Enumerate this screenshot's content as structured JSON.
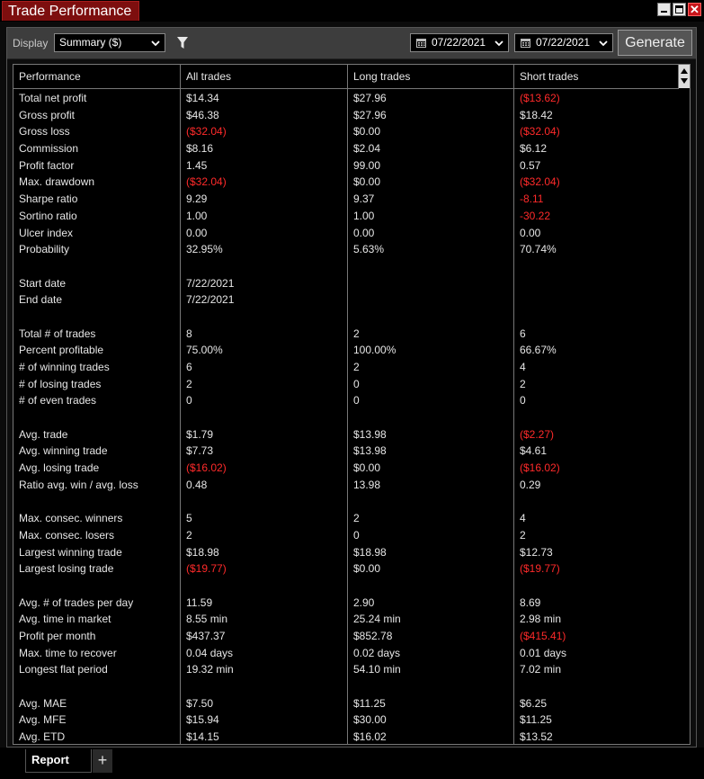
{
  "window": {
    "title": "Trade Performance"
  },
  "toolbar": {
    "display_label": "Display",
    "display_value": "Summary ($)",
    "start_date": "07/22/2021",
    "end_date": "07/22/2021",
    "generate_label": "Generate"
  },
  "table": {
    "headers": [
      "Performance",
      "All trades",
      "Long trades",
      "Short trades"
    ],
    "rows": [
      {
        "label": "Total net profit",
        "all": "$14.34",
        "long": "$27.96",
        "short": "($13.62)",
        "neg": [
          false,
          false,
          true
        ]
      },
      {
        "label": "Gross profit",
        "all": "$46.38",
        "long": "$27.96",
        "short": "$18.42",
        "neg": [
          false,
          false,
          false
        ]
      },
      {
        "label": "Gross loss",
        "all": "($32.04)",
        "long": "$0.00",
        "short": "($32.04)",
        "neg": [
          true,
          false,
          true
        ]
      },
      {
        "label": "Commission",
        "all": "$8.16",
        "long": "$2.04",
        "short": "$6.12",
        "neg": [
          false,
          false,
          false
        ]
      },
      {
        "label": "Profit factor",
        "all": "1.45",
        "long": "99.00",
        "short": "0.57",
        "neg": [
          false,
          false,
          false
        ]
      },
      {
        "label": "Max. drawdown",
        "all": "($32.04)",
        "long": "$0.00",
        "short": "($32.04)",
        "neg": [
          true,
          false,
          true
        ]
      },
      {
        "label": "Sharpe ratio",
        "all": "9.29",
        "long": "9.37",
        "short": "-8.11",
        "neg": [
          false,
          false,
          true
        ]
      },
      {
        "label": "Sortino ratio",
        "all": "1.00",
        "long": "1.00",
        "short": "-30.22",
        "neg": [
          false,
          false,
          true
        ]
      },
      {
        "label": "Ulcer index",
        "all": "0.00",
        "long": "0.00",
        "short": "0.00",
        "neg": [
          false,
          false,
          false
        ]
      },
      {
        "label": "Probability",
        "all": "32.95%",
        "long": "5.63%",
        "short": "70.74%",
        "neg": [
          false,
          false,
          false
        ]
      },
      {
        "label": "",
        "all": "",
        "long": "",
        "short": "",
        "neg": [
          false,
          false,
          false
        ]
      },
      {
        "label": "Start date",
        "all": "7/22/2021",
        "long": "",
        "short": "",
        "neg": [
          false,
          false,
          false
        ]
      },
      {
        "label": "End date",
        "all": "7/22/2021",
        "long": "",
        "short": "",
        "neg": [
          false,
          false,
          false
        ]
      },
      {
        "label": "",
        "all": "",
        "long": "",
        "short": "",
        "neg": [
          false,
          false,
          false
        ]
      },
      {
        "label": "Total # of trades",
        "all": "8",
        "long": "2",
        "short": "6",
        "neg": [
          false,
          false,
          false
        ]
      },
      {
        "label": "Percent profitable",
        "all": "75.00%",
        "long": "100.00%",
        "short": "66.67%",
        "neg": [
          false,
          false,
          false
        ]
      },
      {
        "label": "# of winning trades",
        "all": "6",
        "long": "2",
        "short": "4",
        "neg": [
          false,
          false,
          false
        ]
      },
      {
        "label": "# of losing trades",
        "all": "2",
        "long": "0",
        "short": "2",
        "neg": [
          false,
          false,
          false
        ]
      },
      {
        "label": "# of even trades",
        "all": "0",
        "long": "0",
        "short": "0",
        "neg": [
          false,
          false,
          false
        ]
      },
      {
        "label": "",
        "all": "",
        "long": "",
        "short": "",
        "neg": [
          false,
          false,
          false
        ]
      },
      {
        "label": "Avg. trade",
        "all": "$1.79",
        "long": "$13.98",
        "short": "($2.27)",
        "neg": [
          false,
          false,
          true
        ]
      },
      {
        "label": "Avg. winning trade",
        "all": "$7.73",
        "long": "$13.98",
        "short": "$4.61",
        "neg": [
          false,
          false,
          false
        ]
      },
      {
        "label": "Avg. losing trade",
        "all": "($16.02)",
        "long": "$0.00",
        "short": "($16.02)",
        "neg": [
          true,
          false,
          true
        ]
      },
      {
        "label": "Ratio avg. win / avg. loss",
        "all": "0.48",
        "long": "13.98",
        "short": "0.29",
        "neg": [
          false,
          false,
          false
        ]
      },
      {
        "label": "",
        "all": "",
        "long": "",
        "short": "",
        "neg": [
          false,
          false,
          false
        ]
      },
      {
        "label": "Max. consec. winners",
        "all": "5",
        "long": "2",
        "short": "4",
        "neg": [
          false,
          false,
          false
        ]
      },
      {
        "label": "Max. consec. losers",
        "all": "2",
        "long": "0",
        "short": "2",
        "neg": [
          false,
          false,
          false
        ]
      },
      {
        "label": "Largest winning trade",
        "all": "$18.98",
        "long": "$18.98",
        "short": "$12.73",
        "neg": [
          false,
          false,
          false
        ]
      },
      {
        "label": "Largest losing trade",
        "all": "($19.77)",
        "long": "$0.00",
        "short": "($19.77)",
        "neg": [
          true,
          false,
          true
        ]
      },
      {
        "label": "",
        "all": "",
        "long": "",
        "short": "",
        "neg": [
          false,
          false,
          false
        ]
      },
      {
        "label": "Avg. # of trades per day",
        "all": "11.59",
        "long": "2.90",
        "short": "8.69",
        "neg": [
          false,
          false,
          false
        ]
      },
      {
        "label": "Avg. time in market",
        "all": "8.55 min",
        "long": "25.24 min",
        "short": "2.98 min",
        "neg": [
          false,
          false,
          false
        ]
      },
      {
        "label": "Profit per month",
        "all": "$437.37",
        "long": "$852.78",
        "short": "($415.41)",
        "neg": [
          false,
          false,
          true
        ]
      },
      {
        "label": "Max. time to recover",
        "all": "0.04 days",
        "long": "0.02 days",
        "short": "0.01 days",
        "neg": [
          false,
          false,
          false
        ]
      },
      {
        "label": "Longest flat period",
        "all": "19.32 min",
        "long": "54.10 min",
        "short": "7.02 min",
        "neg": [
          false,
          false,
          false
        ]
      },
      {
        "label": "",
        "all": "",
        "long": "",
        "short": "",
        "neg": [
          false,
          false,
          false
        ]
      },
      {
        "label": "Avg. MAE",
        "all": "$7.50",
        "long": "$11.25",
        "short": "$6.25",
        "neg": [
          false,
          false,
          false
        ]
      },
      {
        "label": "Avg. MFE",
        "all": "$15.94",
        "long": "$30.00",
        "short": "$11.25",
        "neg": [
          false,
          false,
          false
        ]
      },
      {
        "label": "Avg. ETD",
        "all": "$14.15",
        "long": "$16.02",
        "short": "$13.52",
        "neg": [
          false,
          false,
          false
        ]
      }
    ]
  },
  "tabs": {
    "active": "Report",
    "add_label": "+"
  },
  "colors": {
    "title_bg": "#7d0e0e",
    "negative": "#ff2a2a",
    "text": "#e6e6e6"
  }
}
